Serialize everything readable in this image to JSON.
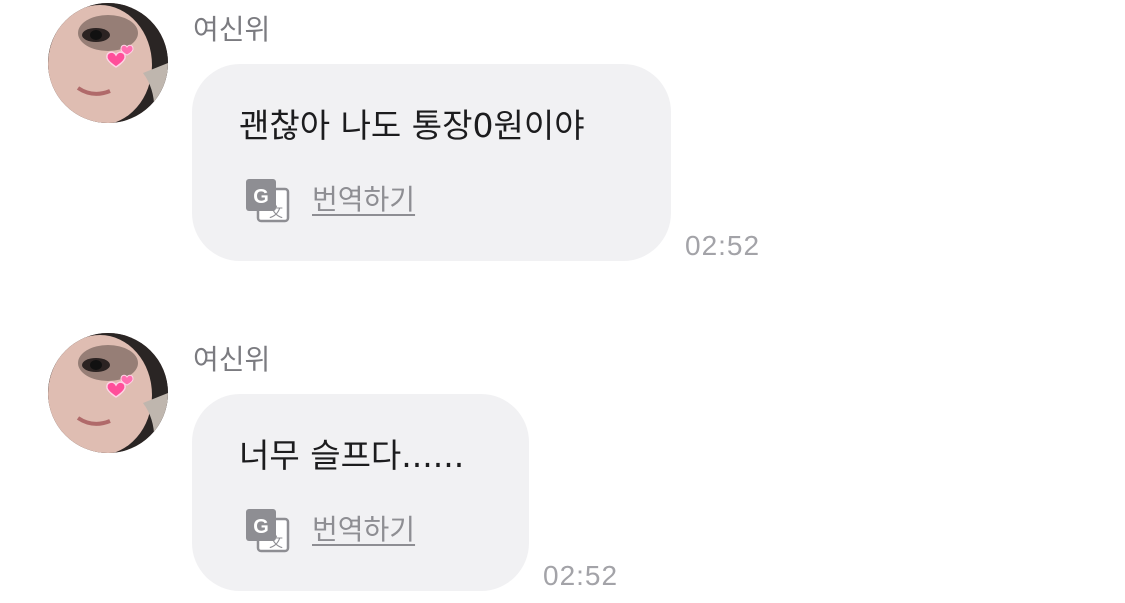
{
  "messages": [
    {
      "sender": "여신위",
      "text": "괜찮아 나도 통장0원이야",
      "translate_label": "번역하기",
      "time": "02:52",
      "avatar_icon": "profile-photo-with-heart-sticker"
    },
    {
      "sender": "여신위",
      "text": "너무 슬프다......",
      "translate_label": "번역하기",
      "time": "02:52",
      "avatar_icon": "profile-photo-with-heart-sticker"
    }
  ],
  "colors": {
    "bubble_background": "#f1f1f3",
    "message_text": "#1c1c1e",
    "sender_name": "#7b7b80",
    "translate_label": "#8e8e93",
    "timestamp": "#a3a3a8",
    "heart_sticker": "#ff4f9a"
  }
}
